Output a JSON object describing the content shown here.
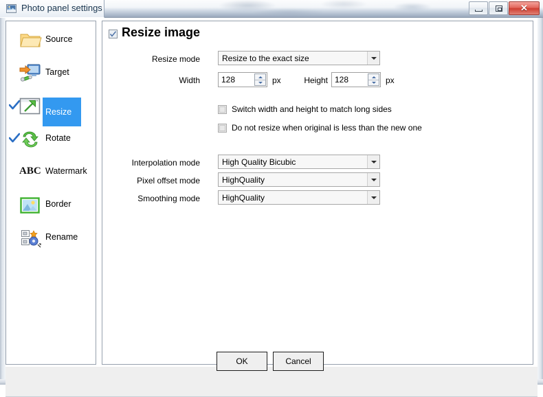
{
  "window": {
    "title": "Photo panel settings",
    "title_icon": "photo-settings-icon",
    "controls": {
      "minimize": "minimize-icon",
      "maximize": "maximize-icon",
      "close": "✕"
    }
  },
  "sidebar": {
    "items": [
      {
        "label": "Source",
        "icon": "folder-icon",
        "checked": false,
        "selected": false
      },
      {
        "label": "Target",
        "icon": "monitor-arrow-icon",
        "checked": false,
        "selected": false
      },
      {
        "label": "Resize",
        "icon": "resize-window-icon",
        "checked": true,
        "selected": true
      },
      {
        "label": "Rotate",
        "icon": "rotate-arrows-icon",
        "checked": true,
        "selected": false
      },
      {
        "label": "Watermark",
        "icon": "abc-text-icon",
        "checked": false,
        "selected": false
      },
      {
        "label": "Border",
        "icon": "picture-frame-icon",
        "checked": false,
        "selected": false
      },
      {
        "label": "Rename",
        "icon": "gear-rename-icon",
        "checked": false,
        "selected": false
      }
    ]
  },
  "main": {
    "header": {
      "title": "Resize image",
      "checked": true
    },
    "resize_mode": {
      "label": "Resize mode",
      "value": "Resize to the exact size"
    },
    "width": {
      "label": "Width",
      "value": "128",
      "unit": "px"
    },
    "height": {
      "label": "Height",
      "value": "128",
      "unit": "px"
    },
    "options": [
      {
        "label": "Switch width and height to match long sides",
        "checked": false
      },
      {
        "label": "Do not resize when original is less than the new one",
        "checked": false
      }
    ],
    "interpolation_mode": {
      "label": "Interpolation mode",
      "value": "High Quality Bicubic"
    },
    "pixel_offset_mode": {
      "label": "Pixel offset mode",
      "value": "HighQuality"
    },
    "smoothing_mode": {
      "label": "Smoothing mode",
      "value": "HighQuality"
    }
  },
  "footer": {
    "ok_label": "OK",
    "cancel_label": "Cancel"
  },
  "colors": {
    "selection_blue": "#3399f0",
    "check_blue": "#2a6ec4",
    "close_red": "#cf3f32"
  }
}
